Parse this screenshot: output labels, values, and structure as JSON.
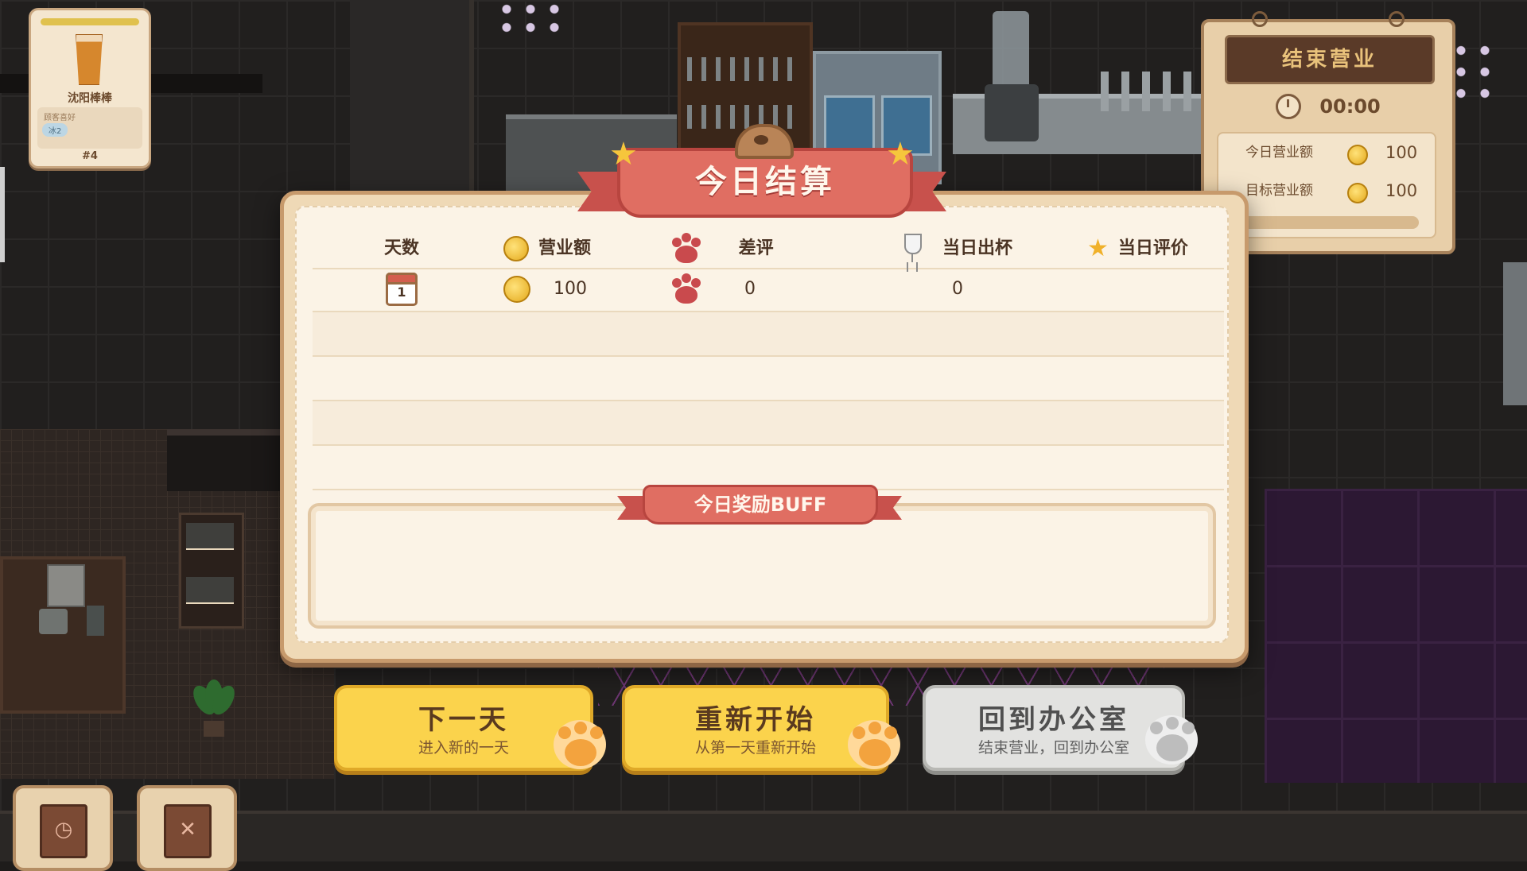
{
  "order_card": {
    "drink_name": "沈阳棒棒",
    "preference_label": "顾客喜好",
    "tag": "冰2",
    "number": "#4"
  },
  "board": {
    "title": "结束营业",
    "time": "00:00",
    "today_revenue_label": "今日营业额",
    "today_revenue_value": "100",
    "target_revenue_label": "目标营业额",
    "target_revenue_value": "100"
  },
  "dialog": {
    "title": "今日结算",
    "columns": {
      "days": "天数",
      "revenue": "营业额",
      "bad_reviews": "差评",
      "cups": "当日出杯",
      "rating": "当日评价"
    },
    "row": {
      "day": "1",
      "revenue": "100",
      "bad_reviews": "0",
      "cups": "0",
      "rating": ""
    },
    "buff_title": "今日奖励BUFF"
  },
  "buttons": {
    "next_day_title": "下一天",
    "next_day_sub": "进入新的一天",
    "restart_title": "重新开始",
    "restart_sub": "从第一天重新开始",
    "office_title": "回到办公室",
    "office_sub": "结束营业，回到办公室"
  },
  "colors": {
    "ribbon": "#e06e62",
    "button_yellow": "#fbd34c",
    "button_grey": "#e2e2e0",
    "coin": "#e4a91c"
  },
  "icons": [
    "clock-icon",
    "coin-icon",
    "calendar-icon",
    "paw-icon",
    "glass-icon",
    "star-icon",
    "book-icon"
  ]
}
